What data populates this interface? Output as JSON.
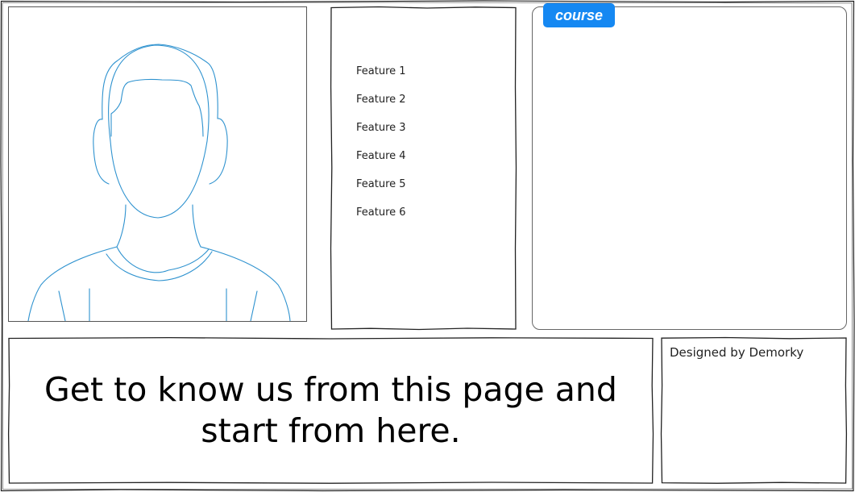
{
  "profile": {
    "avatar_icon": "person-placeholder-icon",
    "line_color": "#2e92cf"
  },
  "features": {
    "items": [
      "Feature 1",
      "Feature 2",
      "Feature 3",
      "Feature 4",
      "Feature 5",
      "Feature 6"
    ]
  },
  "course": {
    "tab_label": "course",
    "tab_color": "#1588f2"
  },
  "hero": {
    "line1": "Get to know us from this page and",
    "line2": "start from here."
  },
  "footer": {
    "credit": "Designed by Demorky"
  }
}
